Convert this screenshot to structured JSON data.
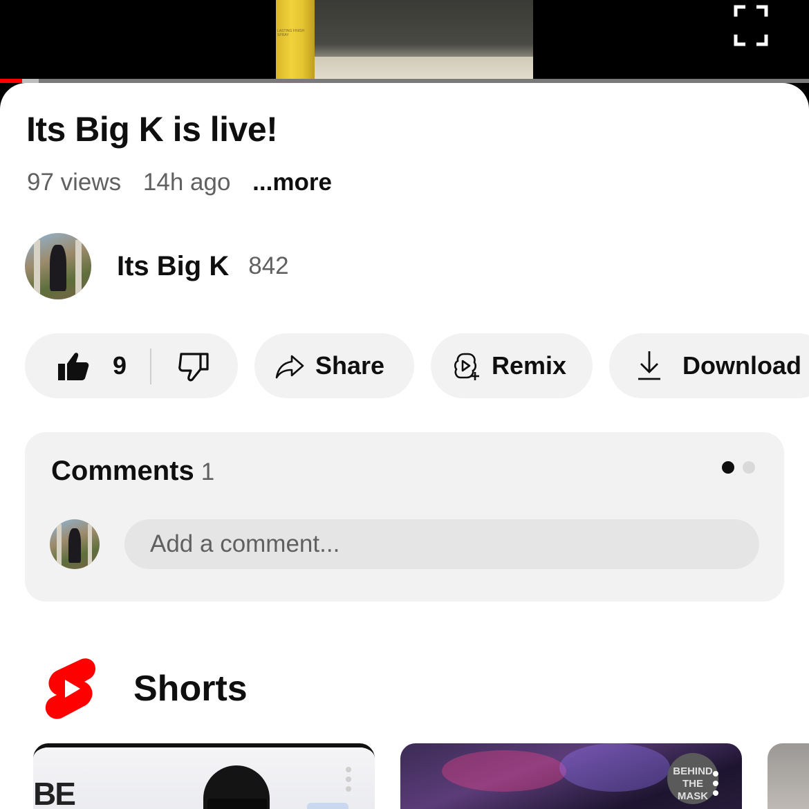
{
  "player": {
    "bottle_label": "LASTING FINISH SPRAY",
    "progress_fraction": 0.027,
    "buffered_fraction": 0.048,
    "progress_color": "#ff0000"
  },
  "video": {
    "title": "Its Big K is live!",
    "views": "97 views",
    "age": "14h ago",
    "more_label": "...more"
  },
  "channel": {
    "name": "Its Big K",
    "subscribers": "842"
  },
  "actions": {
    "like_count": "9",
    "share_label": "Share",
    "remix_label": "Remix",
    "download_label": "Download"
  },
  "comments": {
    "title": "Comments",
    "count": "1",
    "placeholder": "Add a comment...",
    "page_dots": 2,
    "active_dot": 0
  },
  "shorts": {
    "section_title": "Shorts",
    "brand_color": "#ff0000",
    "thumb1_letters": "BE",
    "thumb2_badge": "BEHIND THE MASK"
  },
  "icons": [
    "fullscreen-icon",
    "like-icon",
    "dislike-icon",
    "share-icon",
    "remix-icon",
    "download-icon",
    "shorts-logo-icon",
    "more-vert-icon"
  ]
}
